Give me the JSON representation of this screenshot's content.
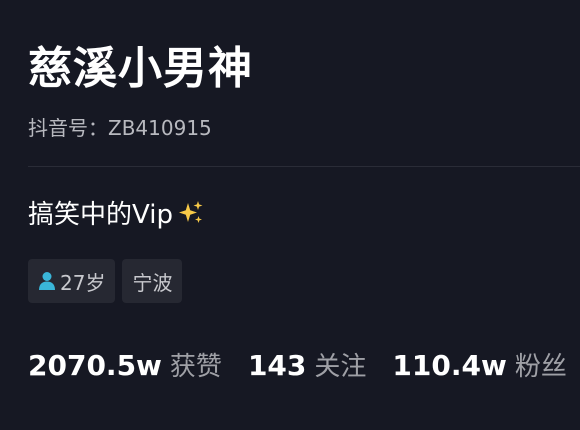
{
  "profile": {
    "nickname": "慈溪小男神",
    "id_text": "抖音号：ZB410915",
    "bio": "搞笑中的Vip",
    "bio_emoji": "sparkles-icon",
    "tags": [
      {
        "icon": "person-icon",
        "label": "27岁"
      },
      {
        "label": "宁波"
      }
    ],
    "stats": [
      {
        "value": "2070.5w",
        "label": "获赞"
      },
      {
        "value": "143",
        "label": "关注"
      },
      {
        "value": "110.4w",
        "label": "粉丝"
      }
    ]
  },
  "colors": {
    "background": "#161823",
    "tag_background": "#262832",
    "person_icon": "#3ab6d9",
    "sparkle": "#f7c948"
  }
}
